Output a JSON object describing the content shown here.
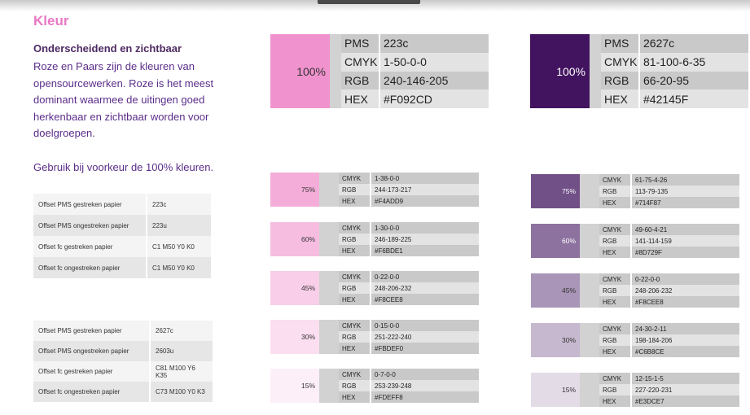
{
  "title": "Kleur",
  "subtitle": "Onderscheidend en zichtbaar",
  "body": "Roze en Paars zijn de kleuren van opensourcewerken. Roze is het meest dominant waarmee de uitingen goed herkenbaar en zichtbaar worden voor doelgroepen.",
  "usage": "Gebruik bij voorkeur de 100% kleuren.",
  "offset_pink": [
    {
      "label": "Offset PMS gestreken papier",
      "value": "223c"
    },
    {
      "label": "Offset PMS ongestreken papier",
      "value": "223u"
    },
    {
      "label": "Offset fc gestreken papier",
      "value": "C1 M50 Y0 K0"
    },
    {
      "label": "Offset fc ongestreken papier",
      "value": "C1 M50 Y0 K0"
    }
  ],
  "offset_purple": [
    {
      "label": "Offset PMS gestreken papier",
      "value": "2627c"
    },
    {
      "label": "Offset PMS ongestreken papier",
      "value": "2603u"
    },
    {
      "label": "Offset fc gestreken papier",
      "value": "C81 M100 Y6 K35"
    },
    {
      "label": "Offset fc ongestreken papier",
      "value": "C73 M100 Y0 K3"
    }
  ],
  "pink": {
    "main": {
      "percent": "100%",
      "color": "#F092CD",
      "rows": [
        {
          "label": "PMS",
          "value": "223c"
        },
        {
          "label": "CMYK",
          "value": "1-50-0-0"
        },
        {
          "label": "RGB",
          "value": "240-146-205"
        },
        {
          "label": "HEX",
          "value": "#F092CD"
        }
      ]
    },
    "tints": [
      {
        "percent": "75%",
        "color": "#F4ADD9",
        "rows": [
          {
            "label": "CMYK",
            "value": "1-38-0-0"
          },
          {
            "label": "RGB",
            "value": "244-173-217"
          },
          {
            "label": "HEX",
            "value": "#F4ADD9"
          }
        ]
      },
      {
        "percent": "60%",
        "color": "#F6BDE1",
        "rows": [
          {
            "label": "CMYK",
            "value": "1-30-0-0"
          },
          {
            "label": "RGB",
            "value": "246-189-225"
          },
          {
            "label": "HEX",
            "value": "#F6BDE1"
          }
        ]
      },
      {
        "percent": "45%",
        "color": "#F8CEE8",
        "rows": [
          {
            "label": "CMYK",
            "value": "0-22-0-0"
          },
          {
            "label": "RGB",
            "value": "248-206-232"
          },
          {
            "label": "HEX",
            "value": "#F8CEE8"
          }
        ]
      },
      {
        "percent": "30%",
        "color": "#FBDEF0",
        "rows": [
          {
            "label": "CMYK",
            "value": "0-15-0-0"
          },
          {
            "label": "RGB",
            "value": "251-222-240"
          },
          {
            "label": "HEX",
            "value": "#FBDEF0"
          }
        ]
      },
      {
        "percent": "15%",
        "color": "#FDEFF8",
        "rows": [
          {
            "label": "CMYK",
            "value": "0-7-0-0"
          },
          {
            "label": "RGB",
            "value": "253-239-248"
          },
          {
            "label": "HEX",
            "value": "#FDEFF8"
          }
        ]
      }
    ]
  },
  "purple": {
    "main": {
      "percent": "100%",
      "color": "#42145F",
      "rows": [
        {
          "label": "PMS",
          "value": "2627c"
        },
        {
          "label": "CMYK",
          "value": "81-100-6-35"
        },
        {
          "label": "RGB",
          "value": "66-20-95"
        },
        {
          "label": "HEX",
          "value": "#42145F"
        }
      ]
    },
    "tints": [
      {
        "percent": "75%",
        "color": "#714F87",
        "rows": [
          {
            "label": "CMYK",
            "value": "61-75-4-26"
          },
          {
            "label": "RGB",
            "value": "113-79-135"
          },
          {
            "label": "HEX",
            "value": "#714F87"
          }
        ]
      },
      {
        "percent": "60%",
        "color": "#8D729F",
        "rows": [
          {
            "label": "CMYK",
            "value": "49-60-4-21"
          },
          {
            "label": "RGB",
            "value": "141-114-159"
          },
          {
            "label": "HEX",
            "value": "#8D729F"
          }
        ]
      },
      {
        "percent": "45%",
        "color": "#A995B7",
        "rows": [
          {
            "label": "CMYK",
            "value": "0-22-0-0"
          },
          {
            "label": "RGB",
            "value": "248-206-232"
          },
          {
            "label": "HEX",
            "value": "#F8CEE8"
          }
        ]
      },
      {
        "percent": "30%",
        "color": "#C6B8CE",
        "rows": [
          {
            "label": "CMYK",
            "value": "24-30-2-11"
          },
          {
            "label": "RGB",
            "value": "198-184-206"
          },
          {
            "label": "HEX",
            "value": "#C6B8CE"
          }
        ]
      },
      {
        "percent": "15%",
        "color": "#E3DCE7",
        "rows": [
          {
            "label": "CMYK",
            "value": "12-15-1-5"
          },
          {
            "label": "RGB",
            "value": "227-220-231"
          },
          {
            "label": "HEX",
            "value": "#E3DCE7"
          }
        ]
      }
    ]
  }
}
